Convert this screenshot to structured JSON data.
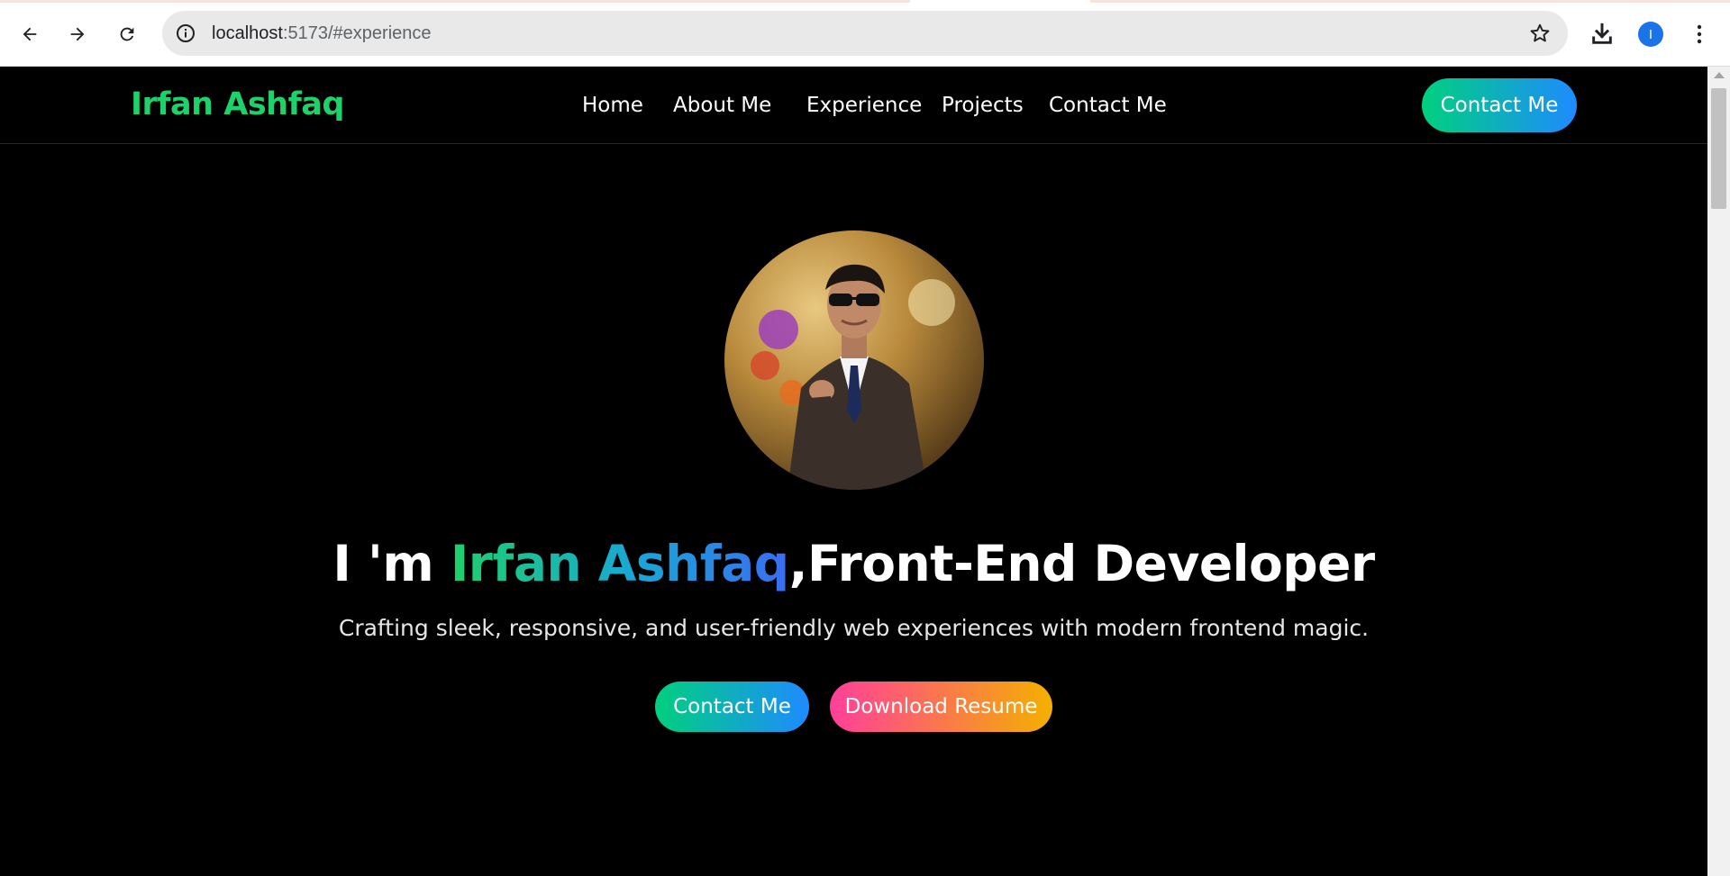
{
  "browser": {
    "url_host": "localhost",
    "url_path": ":5173/#experience",
    "profile_initial": "I",
    "icons": [
      "back-arrow-icon",
      "forward-arrow-icon",
      "reload-icon",
      "info-icon",
      "star-icon",
      "download-icon",
      "more-vert-icon"
    ]
  },
  "header": {
    "brand": "Irfan Ashfaq",
    "nav": [
      "Home",
      "About Me",
      "Experience",
      "Projects",
      "Contact Me"
    ],
    "cta_label": "Contact Me"
  },
  "hero": {
    "headline_prefix": "I 'm ",
    "headline_name": "Irfan Ashfaq",
    "headline_suffix": ",Front-End Developer",
    "tagline": "Crafting sleek, responsive, and user-friendly web experiences with modern frontend magic.",
    "buttons": {
      "contact": "Contact Me",
      "resume": "Download Resume"
    }
  },
  "colors": {
    "accent_green": "#1dd16b",
    "accent_blue": "#1e8bff",
    "resume_pink": "#ff3f9a",
    "resume_orange": "#f4b000"
  }
}
